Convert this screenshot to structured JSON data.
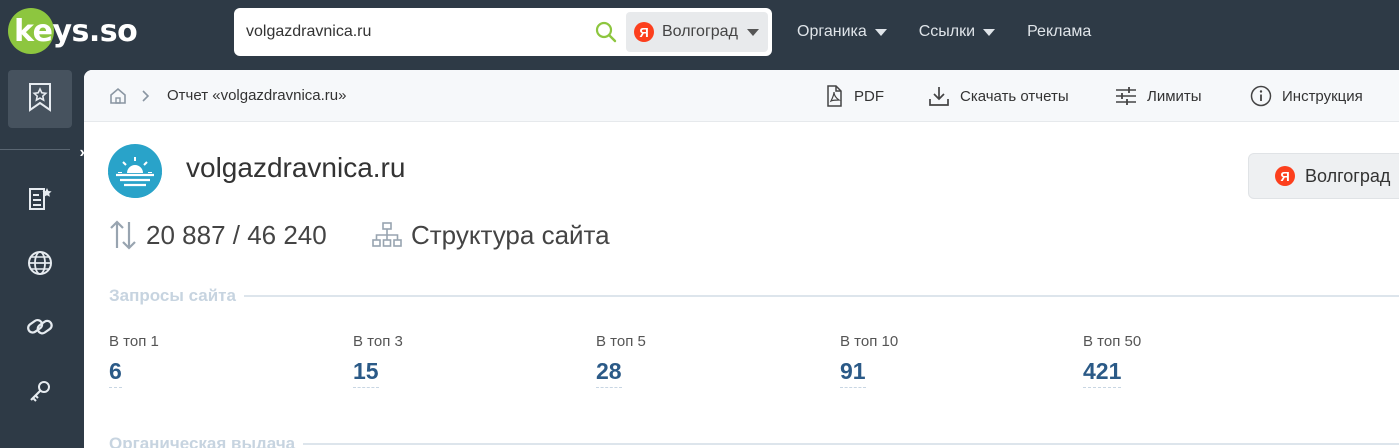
{
  "app": {
    "logo_text": "keys.so"
  },
  "search": {
    "value": "volgazdravnica.ru",
    "region": "Волгоград"
  },
  "topnav": [
    {
      "label": "Органика",
      "dropdown": true
    },
    {
      "label": "Ссылки",
      "dropdown": true
    },
    {
      "label": "Реклама",
      "dropdown": false
    }
  ],
  "sidebar": {
    "items": [
      "bookmark-star-icon",
      "list-star-icon",
      "globe-icon",
      "link-icon",
      "key-icon"
    ],
    "expand_label": "»"
  },
  "breadcrumb": {
    "current": "Отчет «volgazdravnica.ru»"
  },
  "toolbar": {
    "pdf": "PDF",
    "download": "Скачать отчеты",
    "limits": "Лимиты",
    "help": "Инструкция"
  },
  "site": {
    "domain": "volgazdravnica.ru",
    "region": "Волгоград",
    "ya_letter": "Я",
    "pages_ratio": "20 887 / 46 240",
    "structure_label": "Структура сайта"
  },
  "queries": {
    "title": "Запросы сайта",
    "metrics": [
      {
        "label": "В топ 1",
        "value": "6"
      },
      {
        "label": "В топ 3",
        "value": "15"
      },
      {
        "label": "В топ 5",
        "value": "28"
      },
      {
        "label": "В топ 10",
        "value": "91"
      },
      {
        "label": "В топ 50",
        "value": "421"
      }
    ]
  },
  "next_section": {
    "title": "Органическая выдача"
  },
  "colors": {
    "topbar": "#2e3a46",
    "accent_green": "#8dc63f",
    "yandex_red": "#fc3f1d",
    "metric_blue": "#2b5a87",
    "section_title": "#c7d4e0"
  }
}
